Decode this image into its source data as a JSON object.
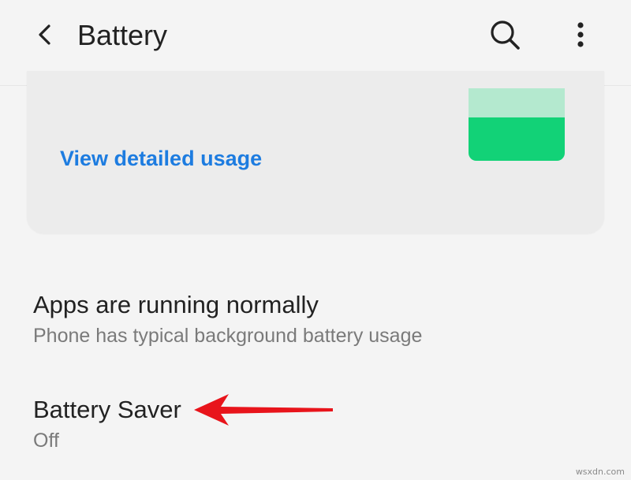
{
  "header": {
    "title": "Battery",
    "back_icon": "arrow-back-icon",
    "search_icon": "search-icon",
    "more_icon": "more-vert-icon"
  },
  "usage_card": {
    "link_label": "View detailed usage",
    "battery_level_fraction": 0.6
  },
  "list": {
    "apps_status": {
      "title": "Apps are running normally",
      "summary": "Phone has typical background battery usage"
    },
    "battery_saver": {
      "title": "Battery Saver",
      "summary": "Off"
    }
  },
  "annotation": {
    "arrow_color": "#e8141b"
  },
  "watermark": "wsxdn.com",
  "colors": {
    "background": "#f4f4f4",
    "card": "#ececec",
    "link": "#1d7ce0",
    "battery_fill": "#12d277",
    "battery_empty": "#b4e9cf"
  }
}
